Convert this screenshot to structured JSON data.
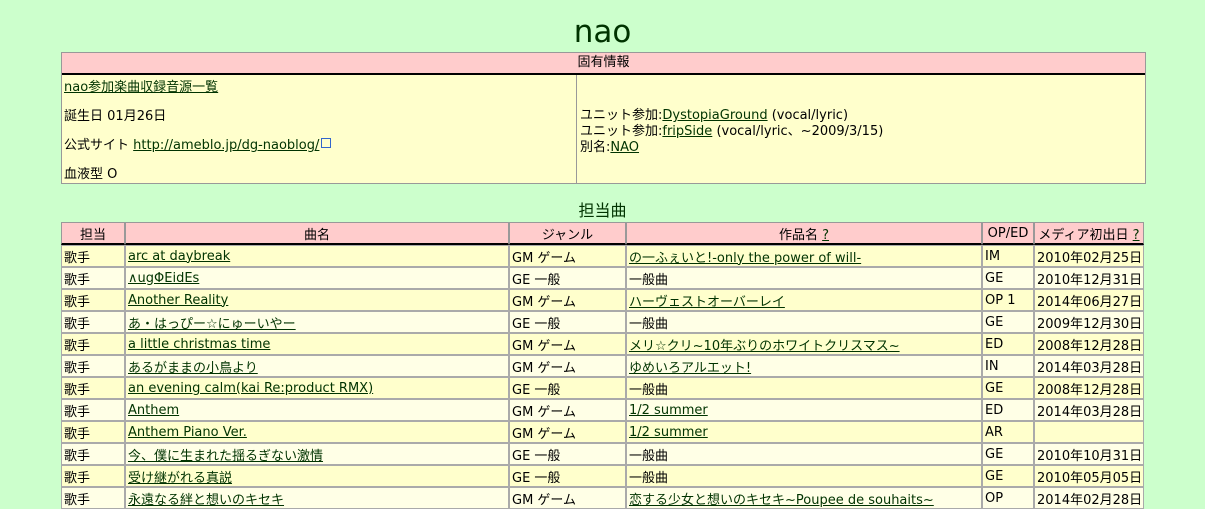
{
  "title": "nao",
  "info": {
    "header": "固有情報",
    "list_link": "nao参加楽曲収録音源一覧",
    "birthday_label": "誕生日",
    "birthday": "01月26日",
    "site_label": "公式サイト",
    "site_url": "http://ameblo.jp/dg-naoblog/",
    "blood_label": "血液型",
    "blood": "O",
    "unit1_label": "ユニット参加:",
    "unit1_name": "DystopiaGround",
    "unit1_note": "(vocal/lyric)",
    "unit2_label": "ユニット参加:",
    "unit2_name": "fripSide",
    "unit2_note": "(vocal/lyric、~2009/3/15)",
    "alias_label": "別名:",
    "alias_name": "NAO"
  },
  "songs_title": "担当曲",
  "columns": [
    "担当",
    "曲名",
    "ジャンル",
    "作品名",
    "OP/ED",
    "メディア初出日"
  ],
  "help_mark": "?",
  "rows": [
    {
      "role": "歌手",
      "song": "arc at daybreak",
      "genre": "GM ゲーム",
      "work": "の一ふぇいと!-only the power of will-",
      "oped": "IM",
      "date": "2010年02月25日"
    },
    {
      "role": "歌手",
      "song": "∧ugΦEidEs",
      "genre": "GE 一般",
      "work": "一般曲",
      "oped": "GE",
      "date": "2010年12月31日"
    },
    {
      "role": "歌手",
      "song": "Another Reality",
      "genre": "GM ゲーム",
      "work": "ハーヴェストオーバーレイ",
      "oped": "OP 1",
      "date": "2014年06月27日"
    },
    {
      "role": "歌手",
      "song": "あ・はっぴー☆にゅーいやー",
      "genre": "GE 一般",
      "work": "一般曲",
      "oped": "GE",
      "date": "2009年12月30日"
    },
    {
      "role": "歌手",
      "song": "a little christmas time",
      "genre": "GM ゲーム",
      "work": "メリ☆クリ~10年ぶりのホワイトクリスマス~",
      "oped": "ED",
      "date": "2008年12月28日"
    },
    {
      "role": "歌手",
      "song": "あるがままの小鳥より",
      "genre": "GM ゲーム",
      "work": "ゆめいろアルエット!",
      "oped": "IN",
      "date": "2014年03月28日"
    },
    {
      "role": "歌手",
      "song": "an evening calm(kai Re:product RMX)",
      "genre": "GE 一般",
      "work": "一般曲",
      "oped": "GE",
      "date": "2008年12月28日"
    },
    {
      "role": "歌手",
      "song": "Anthem",
      "genre": "GM ゲーム",
      "work": "1/2 summer",
      "oped": "ED",
      "date": "2014年03月28日"
    },
    {
      "role": "歌手",
      "song": "Anthem Piano Ver.",
      "genre": "GM ゲーム",
      "work": "1/2 summer",
      "oped": "AR",
      "date": ""
    },
    {
      "role": "歌手",
      "song": "今、僕に生まれた揺るぎない激情",
      "genre": "GE 一般",
      "work": "一般曲",
      "oped": "GE",
      "date": "2010年10月31日"
    },
    {
      "role": "歌手",
      "song": "受け継がれる真説",
      "genre": "GE 一般",
      "work": "一般曲",
      "oped": "GE",
      "date": "2010年05月05日"
    },
    {
      "role": "歌手",
      "song": "永遠なる絆と想いのキセキ",
      "genre": "GM ゲーム",
      "work": "恋する少女と想いのキセキ~Poupee de souhaits~",
      "oped": "OP",
      "date": "2014年02月28日"
    }
  ]
}
